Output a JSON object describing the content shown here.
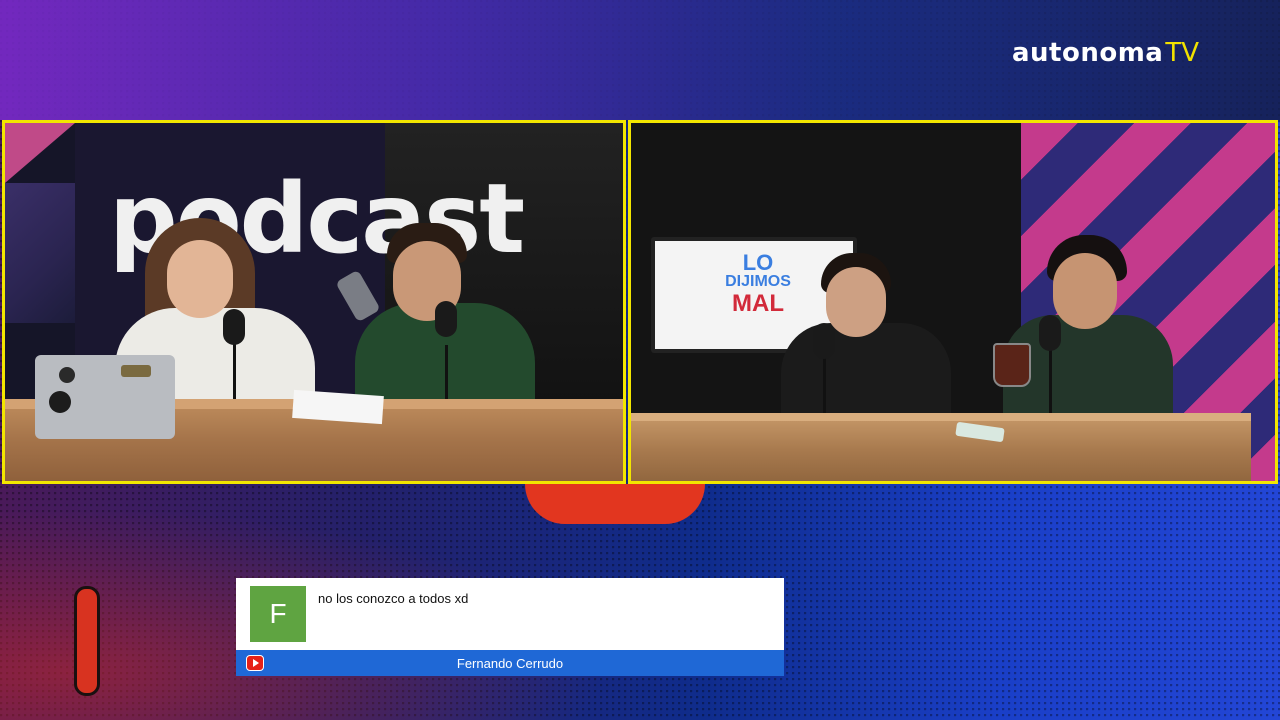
{
  "brand": {
    "logo_main": "autonoma",
    "logo_tv": "TV",
    "accent": "#f2e600"
  },
  "left_video": {
    "backdrop_text": "podcast"
  },
  "right_video": {
    "tv_logo": {
      "line1": "LO",
      "line2": "DIJIMOS",
      "line3": "MAL"
    }
  },
  "chat": {
    "avatar_letter": "F",
    "avatar_color": "#5fa441",
    "message": "no los conozco a todos xd",
    "author": "Fernando Cerrudo",
    "platform_icon": "youtube-icon",
    "footer_color": "#1f68d6"
  }
}
